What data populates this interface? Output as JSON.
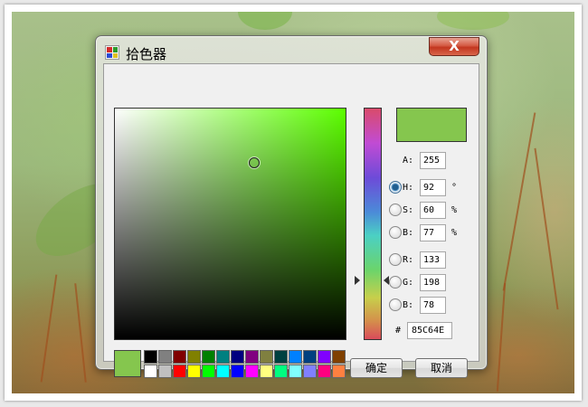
{
  "window": {
    "title": "拾色器",
    "close_label": "X"
  },
  "colors": {
    "selected": "#85C64E",
    "hue_pure": "#5CFF00"
  },
  "fields": {
    "alpha": {
      "label": "A:",
      "value": "255"
    },
    "hue": {
      "label": "H:",
      "value": "92",
      "unit": "°",
      "checked": true
    },
    "saturation": {
      "label": "S:",
      "value": "60",
      "unit": "%"
    },
    "brightness": {
      "label": "B:",
      "value": "77",
      "unit": "%"
    },
    "red": {
      "label": "R:",
      "value": "133"
    },
    "green": {
      "label": "G:",
      "value": "198"
    },
    "blue": {
      "label": "B:",
      "value": "78"
    },
    "hex": {
      "prefix": "#",
      "value": "85C64E"
    }
  },
  "palette": {
    "row1": [
      "#000000",
      "#808080",
      "#800000",
      "#808000",
      "#008000",
      "#008080",
      "#000080",
      "#800080",
      "#808040",
      "#004040",
      "#0080FF",
      "#004080",
      "#8000FF",
      "#804000"
    ],
    "row2": [
      "#FFFFFF",
      "#C0C0C0",
      "#FF0000",
      "#FFFF00",
      "#00FF00",
      "#00FFFF",
      "#0000FF",
      "#FF00FF",
      "#FFFF80",
      "#00FF80",
      "#80FFFF",
      "#8080FF",
      "#FF0080",
      "#FF8040"
    ]
  },
  "buttons": {
    "ok": "确定",
    "cancel": "取消"
  }
}
